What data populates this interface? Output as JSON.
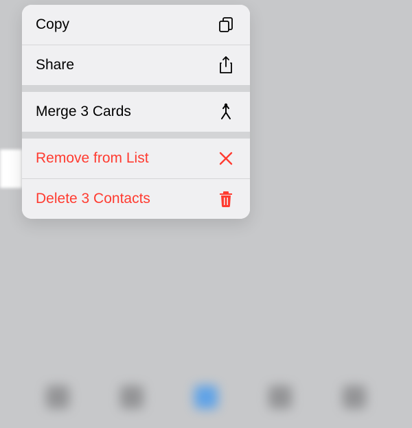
{
  "menu": {
    "copy": "Copy",
    "share": "Share",
    "merge": "Merge 3 Cards",
    "remove": "Remove from List",
    "delete": "Delete 3 Contacts"
  }
}
